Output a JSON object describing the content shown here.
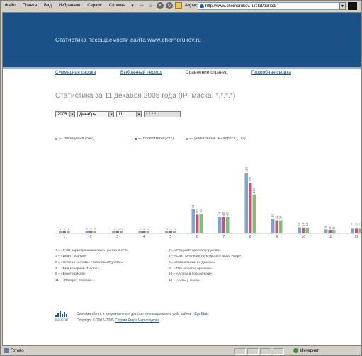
{
  "menubar": {
    "items": [
      "Файл",
      "Правка",
      "Вид",
      "Избранное",
      "Сервис",
      "Справка"
    ]
  },
  "toolbar": {
    "address_label": "Адрес:",
    "url": "http://www.chernorukov.ru/stat/period/"
  },
  "page": {
    "site_title": "Статистика посещаемости сайта www.chernorukov.ru",
    "nav": [
      {
        "label": "Суммарная сводка",
        "link": true
      },
      {
        "label": "Выбранный период",
        "link": true
      },
      {
        "label": "Сравнение страниц",
        "link": false
      },
      {
        "label": "Подробная сводка",
        "link": true
      }
    ],
    "heading": "Статистика за 11 декабря 2005 года (IP–маска: *.*.*.*)",
    "filters": {
      "year": "2005",
      "month": "Декабрь",
      "day": "11",
      "mask": "*.*.*.*"
    },
    "legend": [
      {
        "label": "— посещения (542)",
        "color": "#7fa6cf"
      },
      {
        "label": "— посетители (297)",
        "color": "#c0577a"
      },
      {
        "label": "— уникальные IP–адреса (112)",
        "color": "#82bf74"
      }
    ],
    "captions": [
      "1 – «Сайт термодинамического центра УНГУ»",
      "2 – «Студия Егора Чернорукова»",
      "3 – «Иван Грозный»",
      "4 – «Сайт ОАО Конструкторского Бюро Икар»",
      "5 – «Логотип системы статистики EgoStat»",
      "6 – «Лунная ночь на Днепре»",
      "7 – «Вид северной Италии»",
      "8 – «Постоянство времени»",
      "9 – «Букет ирисов»",
      "10 – «Астры и подсолнухи»",
      "11 – «Портрет Стасова»",
      "12 – «Асты у моста»"
    ],
    "footer": {
      "logo_text": "EGOSTAT",
      "line1_prefix": "Система сбора и представления данных о посещаемости web-сайтов «",
      "line1_link": "EgoStat",
      "line1_suffix": "»",
      "line2_prefix": "Copyright © 2002–2005 ",
      "line2_link": "Студия Егора Чернорукова"
    }
  },
  "statusbar": {
    "left": "Готово",
    "zone": "Интернет"
  },
  "chart_data": {
    "type": "bar",
    "categories": [
      "1",
      "2",
      "3",
      "4",
      "5",
      "6",
      "7",
      "8",
      "9",
      "10",
      "11",
      "12"
    ],
    "series": [
      {
        "name": "посещения",
        "color": "#7fa6cf",
        "values": [
          4,
          5,
          3,
          4,
          3,
          65,
          45,
          164,
          39,
          15,
          9,
          13
        ]
      },
      {
        "name": "посетители",
        "color": "#c0577a",
        "values": [
          4,
          5,
          3,
          4,
          3,
          50,
          43,
          137,
          34,
          14,
          8,
          13
        ]
      },
      {
        "name": "уникальные IP–адреса",
        "color": "#82bf74",
        "values": [
          4,
          5,
          3,
          4,
          3,
          52,
          43,
          106,
          34,
          14,
          8,
          13
        ]
      }
    ],
    "ylim": [
      0,
      164
    ],
    "grid": false,
    "legend_position": "top"
  }
}
